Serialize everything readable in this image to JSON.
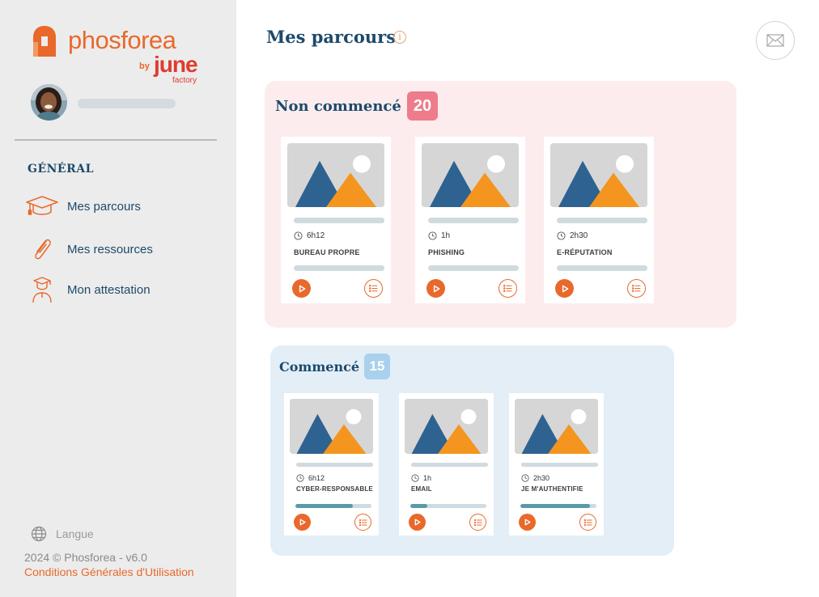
{
  "brand": {
    "name": "phosforea",
    "by": "by",
    "partner": "june",
    "partner_sub": "factory",
    "orange": "#e8692b",
    "navy": "#1c4a6b"
  },
  "sidebar": {
    "section_title": "GÉNÉRAL",
    "items": [
      {
        "label": "Mes parcours",
        "icon": "graduation-cap-icon"
      },
      {
        "label": "Mes ressources",
        "icon": "paperclip-icon"
      },
      {
        "label": "Mon attestation",
        "icon": "graduate-person-icon"
      }
    ],
    "language_label": "Langue",
    "copyright": "2024 © Phosforea - v6.0",
    "terms_link": "Conditions Générales d'Utilisation"
  },
  "main": {
    "title": "Mes parcours",
    "info_icon": "i",
    "sections": [
      {
        "title": "Non commencé",
        "count": "20",
        "badge_color": "#ee7c8a",
        "cards": [
          {
            "duration": "6h12",
            "title": "BUREAU PROPRE"
          },
          {
            "duration": "1h",
            "title": "PHISHING"
          },
          {
            "duration": "2h30",
            "title": "E-RÉPUTATION"
          }
        ]
      },
      {
        "title": "Commencé",
        "count": "15",
        "badge_color": "#a9d0ec",
        "cards": [
          {
            "duration": "6h12",
            "title": "CYBER-RESPONSABLE",
            "progress": 0.76
          },
          {
            "duration": "1h",
            "title": "EMAIL",
            "progress": 0.22
          },
          {
            "duration": "2h30",
            "title": "JE M'AUTHENTIFIE",
            "progress": 0.92
          }
        ]
      }
    ]
  }
}
